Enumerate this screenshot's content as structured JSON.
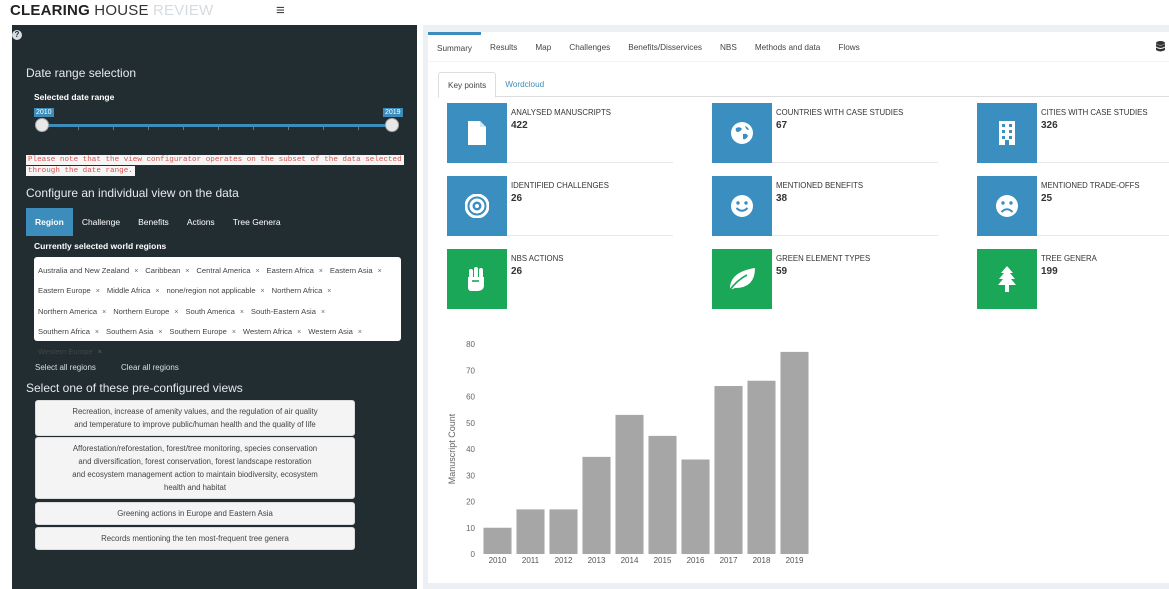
{
  "brand": {
    "part1": "CLEARING",
    "part2": " HOUSE ",
    "part3": "REVIEW"
  },
  "sidebar": {
    "date_heading": "Date range selection",
    "range_label": "Selected date range",
    "range_min": "2010",
    "range_max": "2019",
    "note_line1": "Please note that the view configurator operates on the subset of the data selected",
    "note_line2": "through the date range.",
    "config_heading": "Configure an individual view on the data",
    "tabs": [
      "Region",
      "Challenge",
      "Benefits",
      "Actions",
      "Tree Genera"
    ],
    "regions_label": "Currently selected world regions",
    "regions": [
      "Australia and New Zealand",
      "Caribbean",
      "Central America",
      "Eastern Africa",
      "Eastern Asia",
      "Eastern Europe",
      "Middle Africa",
      "none/region not applicable",
      "Northern Africa",
      "Northern America",
      "Northern Europe",
      "South America",
      "South-Eastern Asia",
      "Southern Africa",
      "Southern Asia",
      "Southern Europe",
      "Western Africa",
      "Western Asia",
      "Western Europe"
    ],
    "select_all": "Select all regions",
    "clear_all": "Clear all regions",
    "preset_heading": "Select one of these pre-configured views",
    "presets": [
      [
        "Recreation, increase of amenity values, and the regulation of air quality",
        "and temperature to improve public/human health and the quality of life"
      ],
      [
        "Afforestation/reforestation, forest/tree monitoring, species conservation",
        "and diversification, forest conservation, forest landscape restoration",
        "and ecosystem management action to maintain biodiversity, ecosystem",
        "health and habitat"
      ],
      [
        "Greening actions in Europe and Eastern Asia"
      ],
      [
        "Records mentioning the ten most-frequent tree genera"
      ]
    ]
  },
  "main": {
    "tabs": [
      "Summary",
      "Results",
      "Map",
      "Challenges",
      "Benefits/Disservices",
      "NBS",
      "Methods and data",
      "Flows"
    ],
    "subtabs": [
      "Key points",
      "Wordcloud"
    ],
    "infoboxes": [
      {
        "label": "ANALYSED MANUSCRIPTS",
        "value": "422",
        "icon": "file-icon",
        "color": "#3a8ec0"
      },
      {
        "label": "COUNTRIES WITH CASE STUDIES",
        "value": "67",
        "icon": "globe-icon",
        "color": "#3a8ec0"
      },
      {
        "label": "CITIES WITH CASE STUDIES",
        "value": "326",
        "icon": "building-icon",
        "color": "#3a8ec0"
      },
      {
        "label": "IDENTIFIED CHALLENGES",
        "value": "26",
        "icon": "bullseye-icon",
        "color": "#3a8ec0"
      },
      {
        "label": "MENTIONED BENEFITS",
        "value": "38",
        "icon": "smile-icon",
        "color": "#3a8ec0"
      },
      {
        "label": "MENTIONED TRADE-OFFS",
        "value": "25",
        "icon": "frown-icon",
        "color": "#3a8ec0"
      },
      {
        "label": "NBS ACTIONS",
        "value": "26",
        "icon": "fist-icon",
        "color": "#1aa757"
      },
      {
        "label": "GREEN ELEMENT TYPES",
        "value": "59",
        "icon": "leaf-icon",
        "color": "#1aa757"
      },
      {
        "label": "TREE GENERA",
        "value": "199",
        "icon": "tree-icon",
        "color": "#1aa757"
      }
    ]
  },
  "chart_data": {
    "type": "bar",
    "categories": [
      "2010",
      "2011",
      "2012",
      "2013",
      "2014",
      "2015",
      "2016",
      "2017",
      "2018",
      "2019"
    ],
    "values": [
      10,
      17,
      17,
      37,
      53,
      45,
      36,
      64,
      66,
      77
    ],
    "xlabel": "",
    "ylabel": "Manuscript Count",
    "ylim": [
      0,
      80
    ],
    "yticks": [
      0,
      10,
      20,
      30,
      40,
      50,
      60,
      70,
      80
    ],
    "bar_color": "#a6a6a6",
    "grid": false
  }
}
